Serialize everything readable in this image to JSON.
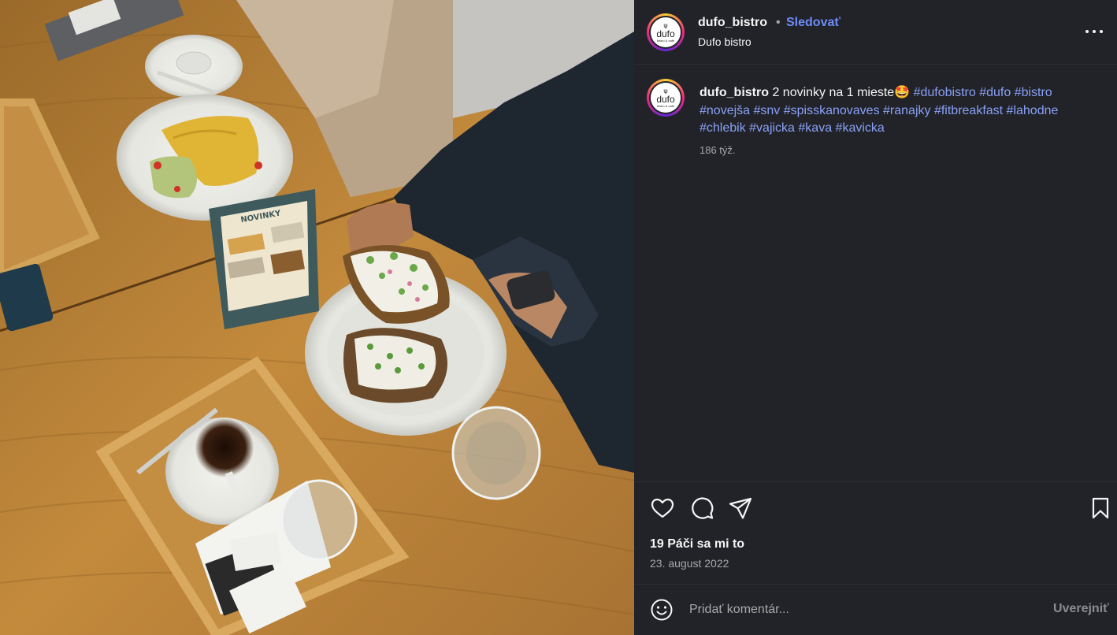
{
  "post": {
    "username": "dufo_bistro",
    "separator": "•",
    "follow_label": "Sledovať",
    "location": "Dufo bistro",
    "avatar": {
      "fork_glyph": "ψ",
      "logo_text": "dufo",
      "logo_sub": "bistro & cafe"
    },
    "photo": {
      "menu_stand_title": "NOVINKY"
    },
    "caption": {
      "username": "dufo_bistro",
      "text": "2 novinky na 1 mieste🤩",
      "hashtags": "#dufobistro #dufo #bistro #novejša #snv #spisskanovaves #ranajky #fitbreakfast #lahodne #chlebik #vajicka #kava #kavicka",
      "time": "186 týž."
    },
    "icons": {
      "more": "more-horizontal-icon",
      "like": "heart-icon",
      "comment": "comment-icon",
      "share": "paper-plane-icon",
      "save": "bookmark-icon",
      "emoji": "emoji-icon"
    },
    "likes": "19 Páči sa mi to",
    "date": "23. august 2022",
    "comment": {
      "placeholder": "Pridať komentár...",
      "post_label": "Uverejniť"
    },
    "colors": {
      "panel_bg": "#212328",
      "link": "#6d8cf9",
      "hashtag": "#8aa0f7",
      "muted": "#a8a8a8"
    }
  }
}
